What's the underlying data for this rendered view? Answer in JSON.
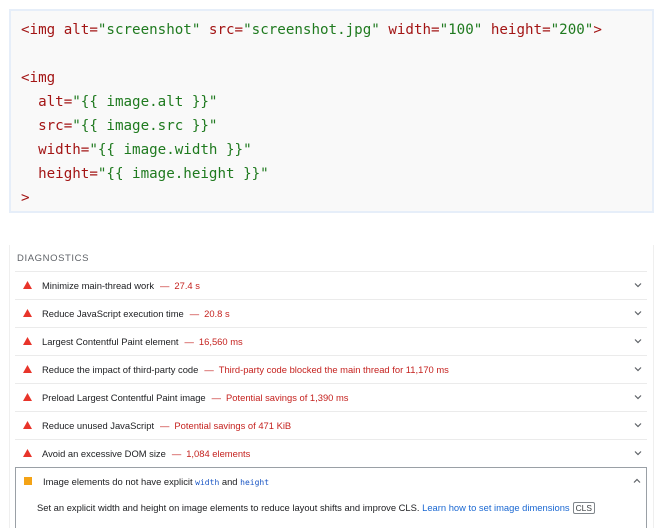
{
  "code": {
    "line1": {
      "open": "<img",
      "alt_attr": " alt=",
      "alt_val": "\"screenshot\"",
      "src_attr": " src=",
      "src_val": "\"screenshot.jpg\"",
      "width_attr": " width=",
      "width_val": "\"100\"",
      "height_attr": " height=",
      "height_val": "\"200\"",
      "close": ">"
    },
    "block2": {
      "open": "<img",
      "alt_attr": "  alt=",
      "alt_val": "\"{{ image.alt }}\"",
      "src_attr": "  src=",
      "src_val": "\"{{ image.src }}\"",
      "width_attr": "  width=",
      "width_val": "\"{{ image.width }}\"",
      "height_attr": "  height=",
      "height_val": "\"{{ image.height }}\"",
      "close": ">"
    }
  },
  "diagnostics": {
    "heading": "DIAGNOSTICS",
    "audits": [
      {
        "title": "Minimize main-thread work",
        "sep": "—",
        "value": "27.4 s",
        "status": "fail"
      },
      {
        "title": "Reduce JavaScript execution time",
        "sep": "—",
        "value": "20.8 s",
        "status": "fail"
      },
      {
        "title": "Largest Contentful Paint element",
        "sep": "—",
        "value": "16,560 ms",
        "status": "fail"
      },
      {
        "title": "Reduce the impact of third-party code",
        "sep": "—",
        "value": "Third-party code blocked the main thread for 11,170 ms",
        "status": "fail"
      },
      {
        "title": "Preload Largest Contentful Paint image",
        "sep": "—",
        "value": "Potential savings of 1,390 ms",
        "status": "fail"
      },
      {
        "title": "Reduce unused JavaScript",
        "sep": "—",
        "value": "Potential savings of 471 KiB",
        "status": "fail"
      },
      {
        "title": "Avoid an excessive DOM size",
        "sep": "—",
        "value": "1,084 elements",
        "status": "fail"
      }
    ],
    "expanded": {
      "title_prefix": "Image elements do not have explicit ",
      "code1": "width",
      "and": " and ",
      "code2": "height",
      "status": "average",
      "description": "Set an explicit width and height on image elements to reduce layout shifts and improve CLS. ",
      "link": "Learn how to set image dimensions",
      "badge": "CLS"
    }
  },
  "colors": {
    "fail": "#e8342a",
    "average": "#f4a316",
    "link": "#1967d2"
  }
}
